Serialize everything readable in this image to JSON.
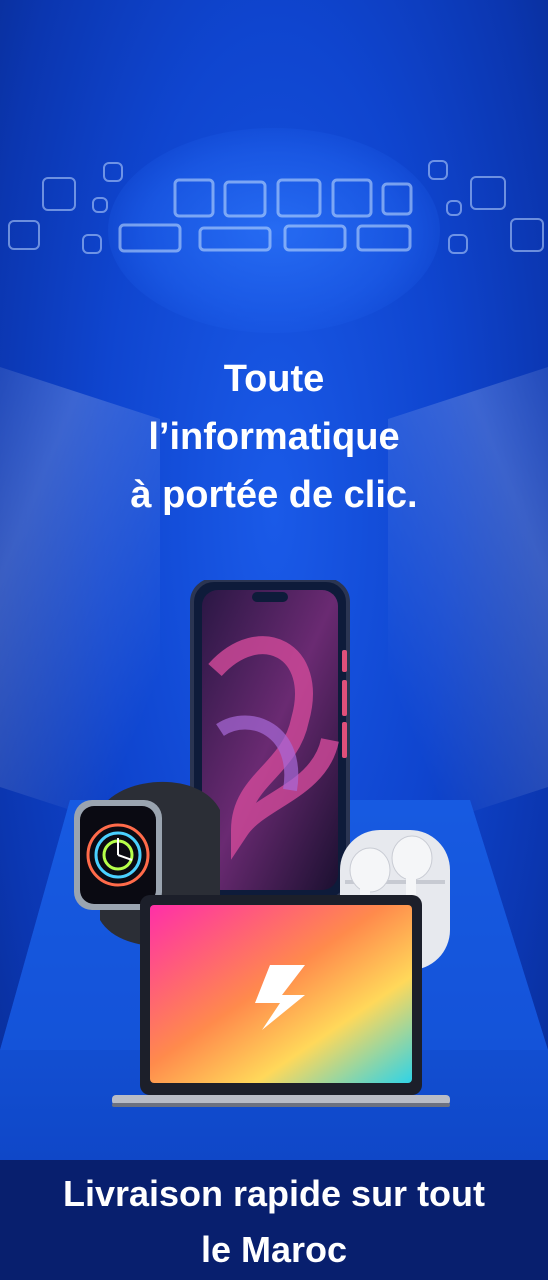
{
  "headline": {
    "line1": "Toute",
    "line2": "l’informatique",
    "line3": "à portée de clic."
  },
  "footer": {
    "line1": "Livraison rapide sur tout",
    "line2": "le Maroc"
  },
  "colors": {
    "background": "#0f45cf",
    "footer": "#081f6e",
    "platform": "#1556dd"
  }
}
